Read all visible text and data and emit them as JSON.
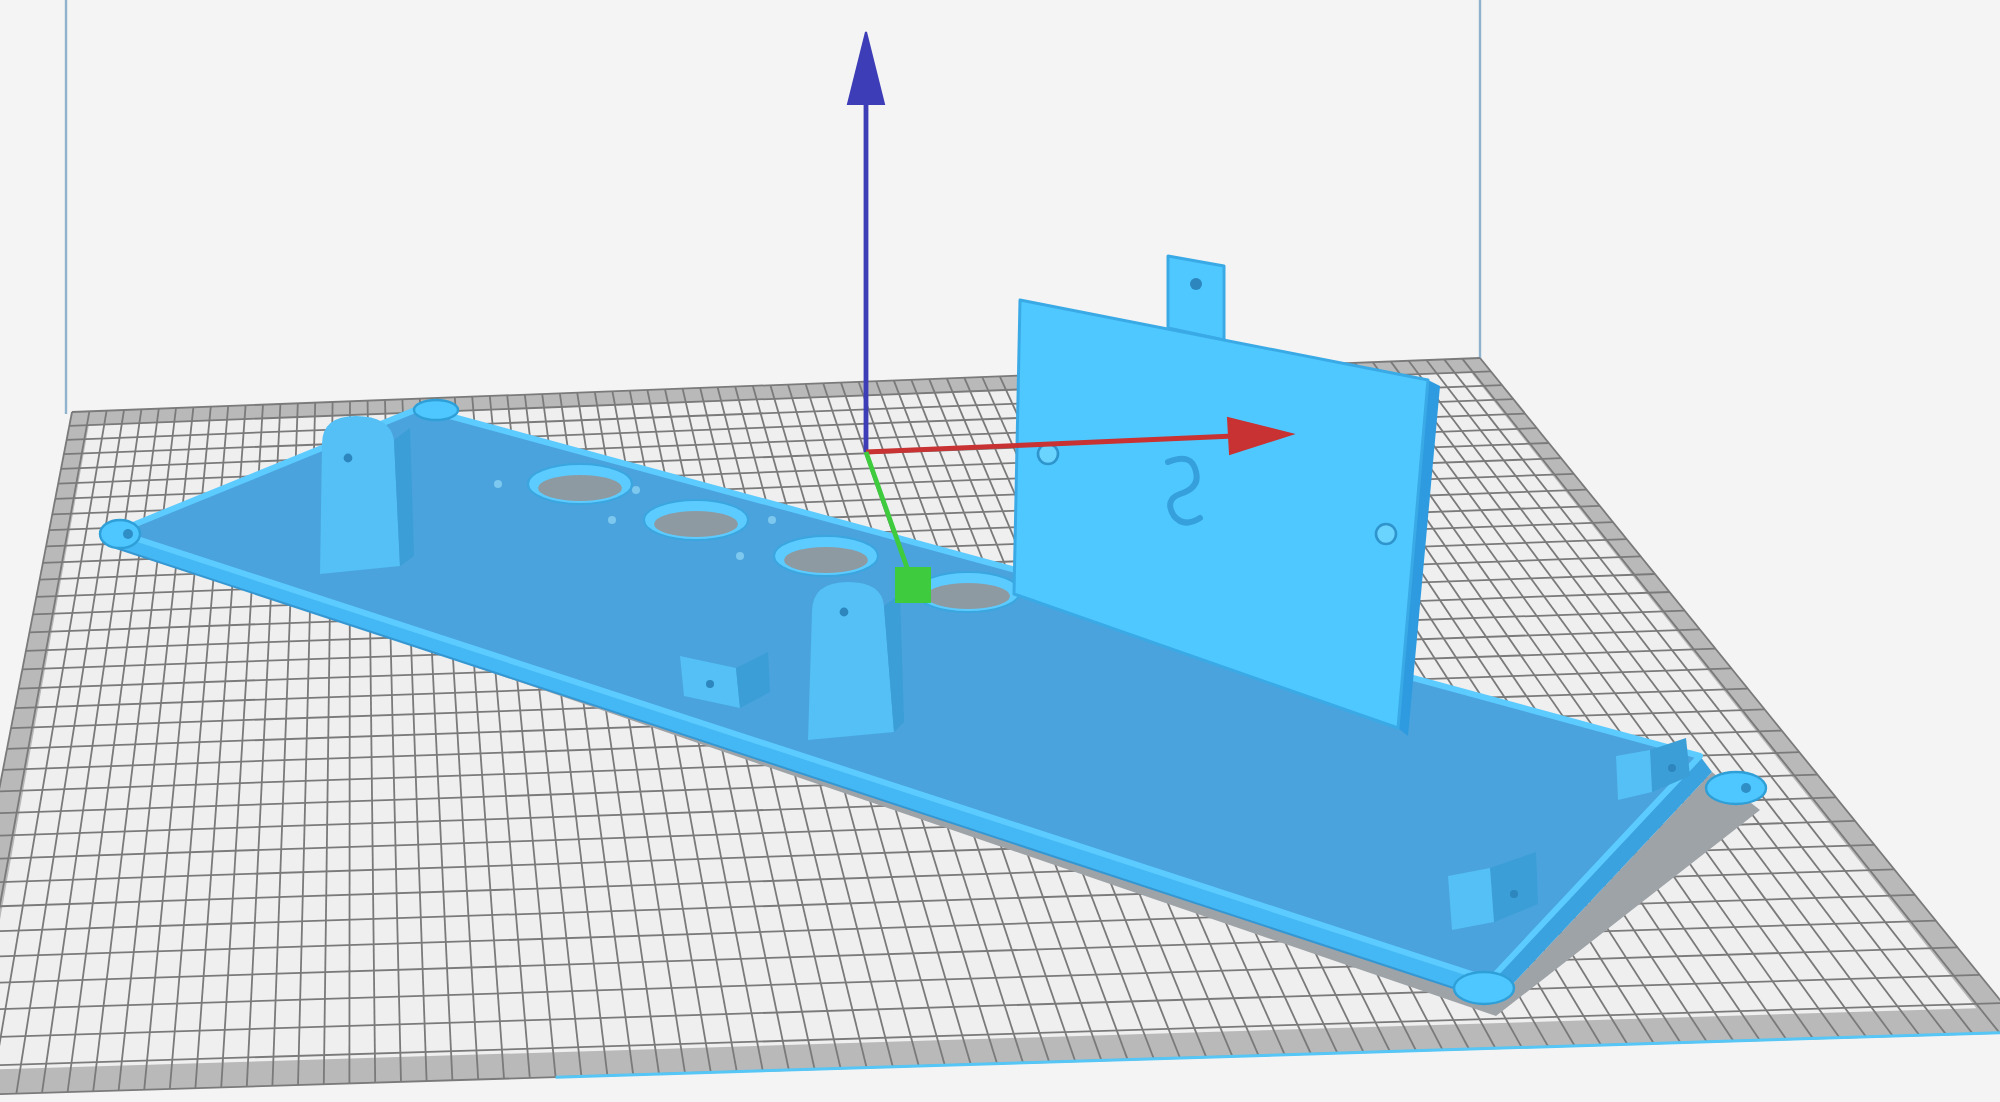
{
  "viewport": {
    "axes": [
      {
        "kind": "z",
        "color": "#3d3db8"
      },
      {
        "kind": "x",
        "color": "#c83232"
      },
      {
        "kind": "y",
        "color": "#3ecc3e"
      }
    ]
  }
}
